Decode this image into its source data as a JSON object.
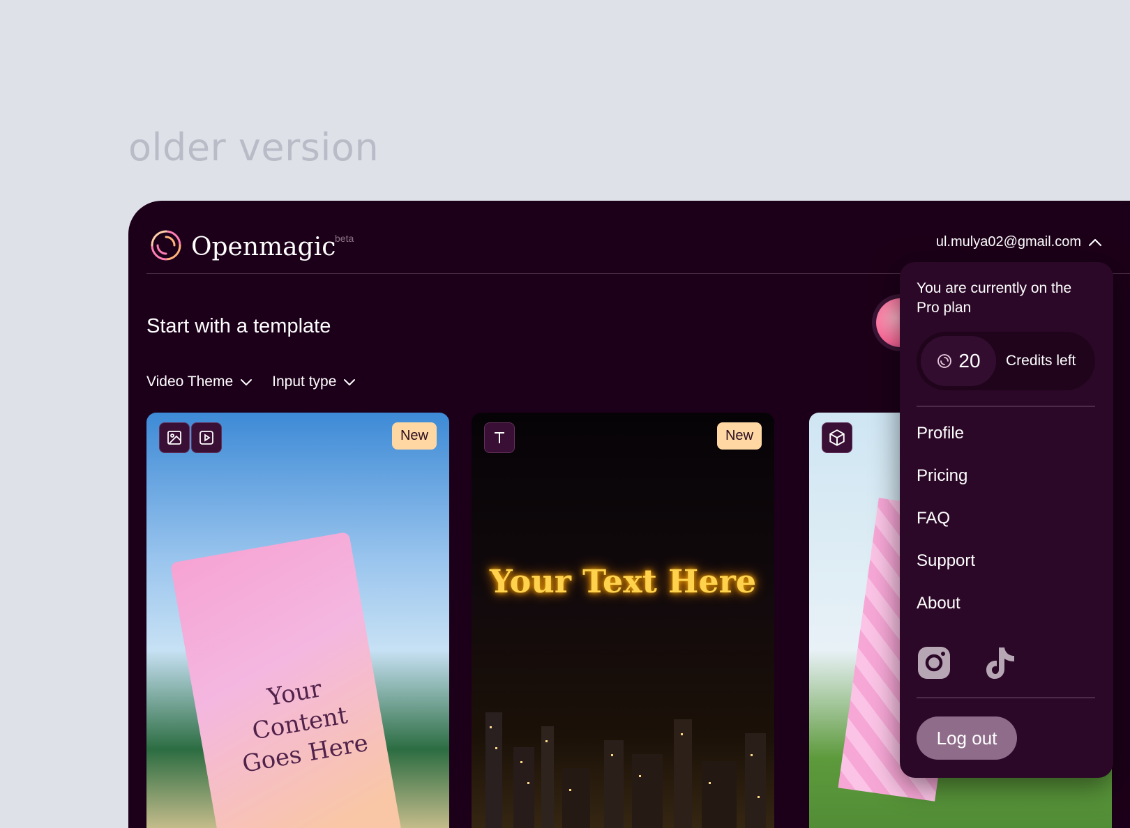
{
  "caption": "older version",
  "header": {
    "brand": "Openmagic",
    "beta": "beta",
    "account_email": "ul.mulya02@gmail.com"
  },
  "main": {
    "title": "Start with a template",
    "filters": [
      {
        "label": "Video Theme"
      },
      {
        "label": "Input type"
      }
    ],
    "cards": [
      {
        "badge": "New",
        "text_line1": "Your Content",
        "text_line2": "Goes Here"
      },
      {
        "badge": "New",
        "text": "Your Text Here"
      },
      {}
    ]
  },
  "menu": {
    "plan_text": "You are currently on the Pro plan",
    "credits_count": "20",
    "credits_label": "Credits left",
    "items": [
      {
        "label": "Profile"
      },
      {
        "label": "Pricing"
      },
      {
        "label": "FAQ"
      },
      {
        "label": "Support"
      },
      {
        "label": "About"
      }
    ],
    "social_icons": [
      "instagram-icon",
      "tiktok-icon"
    ],
    "logout_label": "Log out"
  },
  "colors": {
    "background": "#dfe1e8",
    "app_bg": "#1c0019",
    "menu_bg": "#2b0827",
    "new_badge": "#ffd7a3",
    "logout_button": "#8f6c8a"
  }
}
